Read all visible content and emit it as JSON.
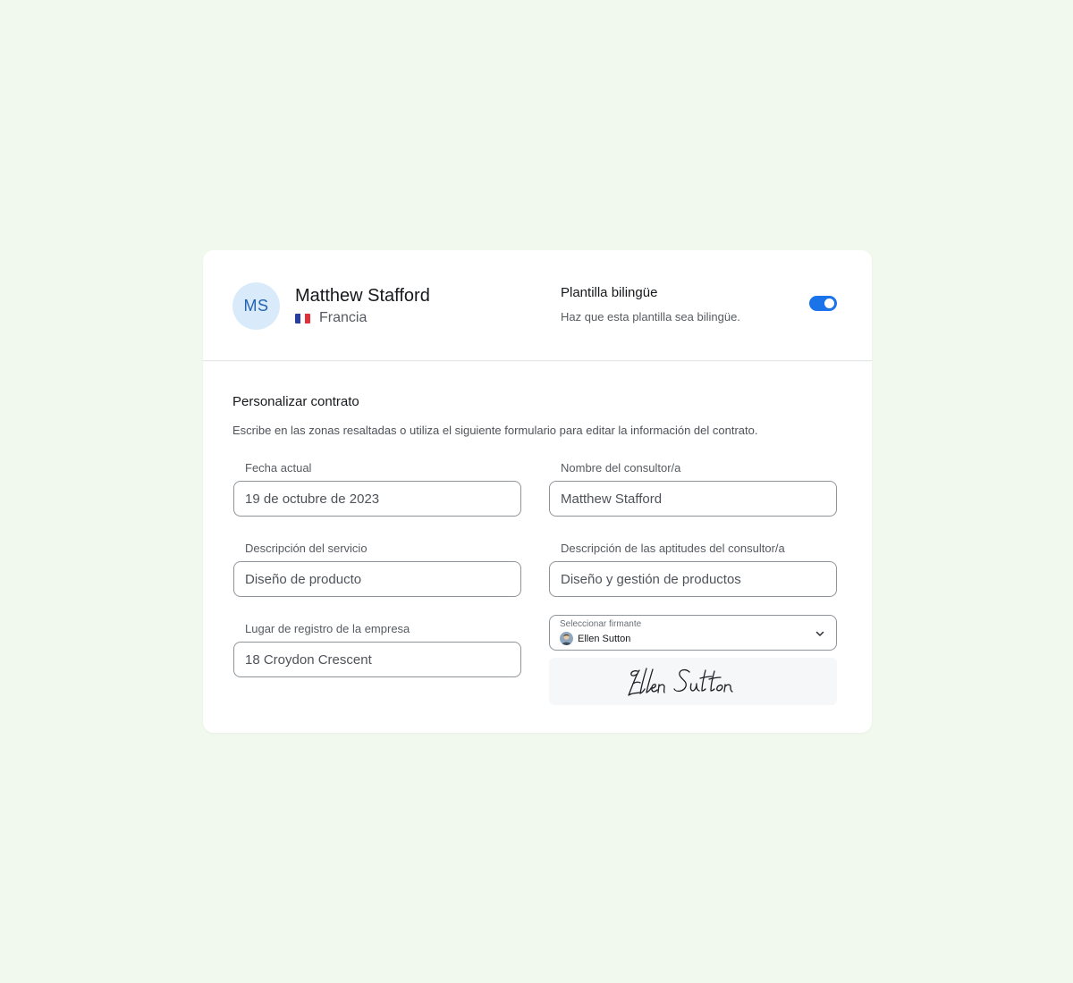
{
  "header": {
    "avatar_initials": "MS",
    "user_name": "Matthew Stafford",
    "country": "Francia",
    "country_flag": "flag-france-icon",
    "bilingual_title": "Plantilla bilingüe",
    "bilingual_description": "Haz que esta plantilla sea bilingüe.",
    "bilingual_enabled": true
  },
  "section": {
    "title": "Personalizar contrato",
    "description": "Escribe en las zonas resaltadas o utiliza el siguiente formulario para editar la información del contrato."
  },
  "fields": {
    "current_date": {
      "label": "Fecha actual",
      "value": "19 de octubre de 2023"
    },
    "consultant_name": {
      "label": "Nombre del consultor/a",
      "value": "Matthew Stafford"
    },
    "service_description": {
      "label": "Descripción del servicio",
      "value": "Diseño de producto"
    },
    "consultant_skills": {
      "label": "Descripción de las aptitudes del consultor/a",
      "value": "Diseño y gestión de productos"
    },
    "company_registration": {
      "label": "Lugar de registro de la empresa",
      "value": "18 Croydon Crescent"
    }
  },
  "signer_select": {
    "label": "Seleccionar firmante",
    "value": "Ellen Sutton",
    "signature_text": "Ellen Sutton"
  },
  "colors": {
    "background": "#f1f8ee",
    "accent": "#1a73e8",
    "avatar_bg": "#d9ebfb"
  }
}
